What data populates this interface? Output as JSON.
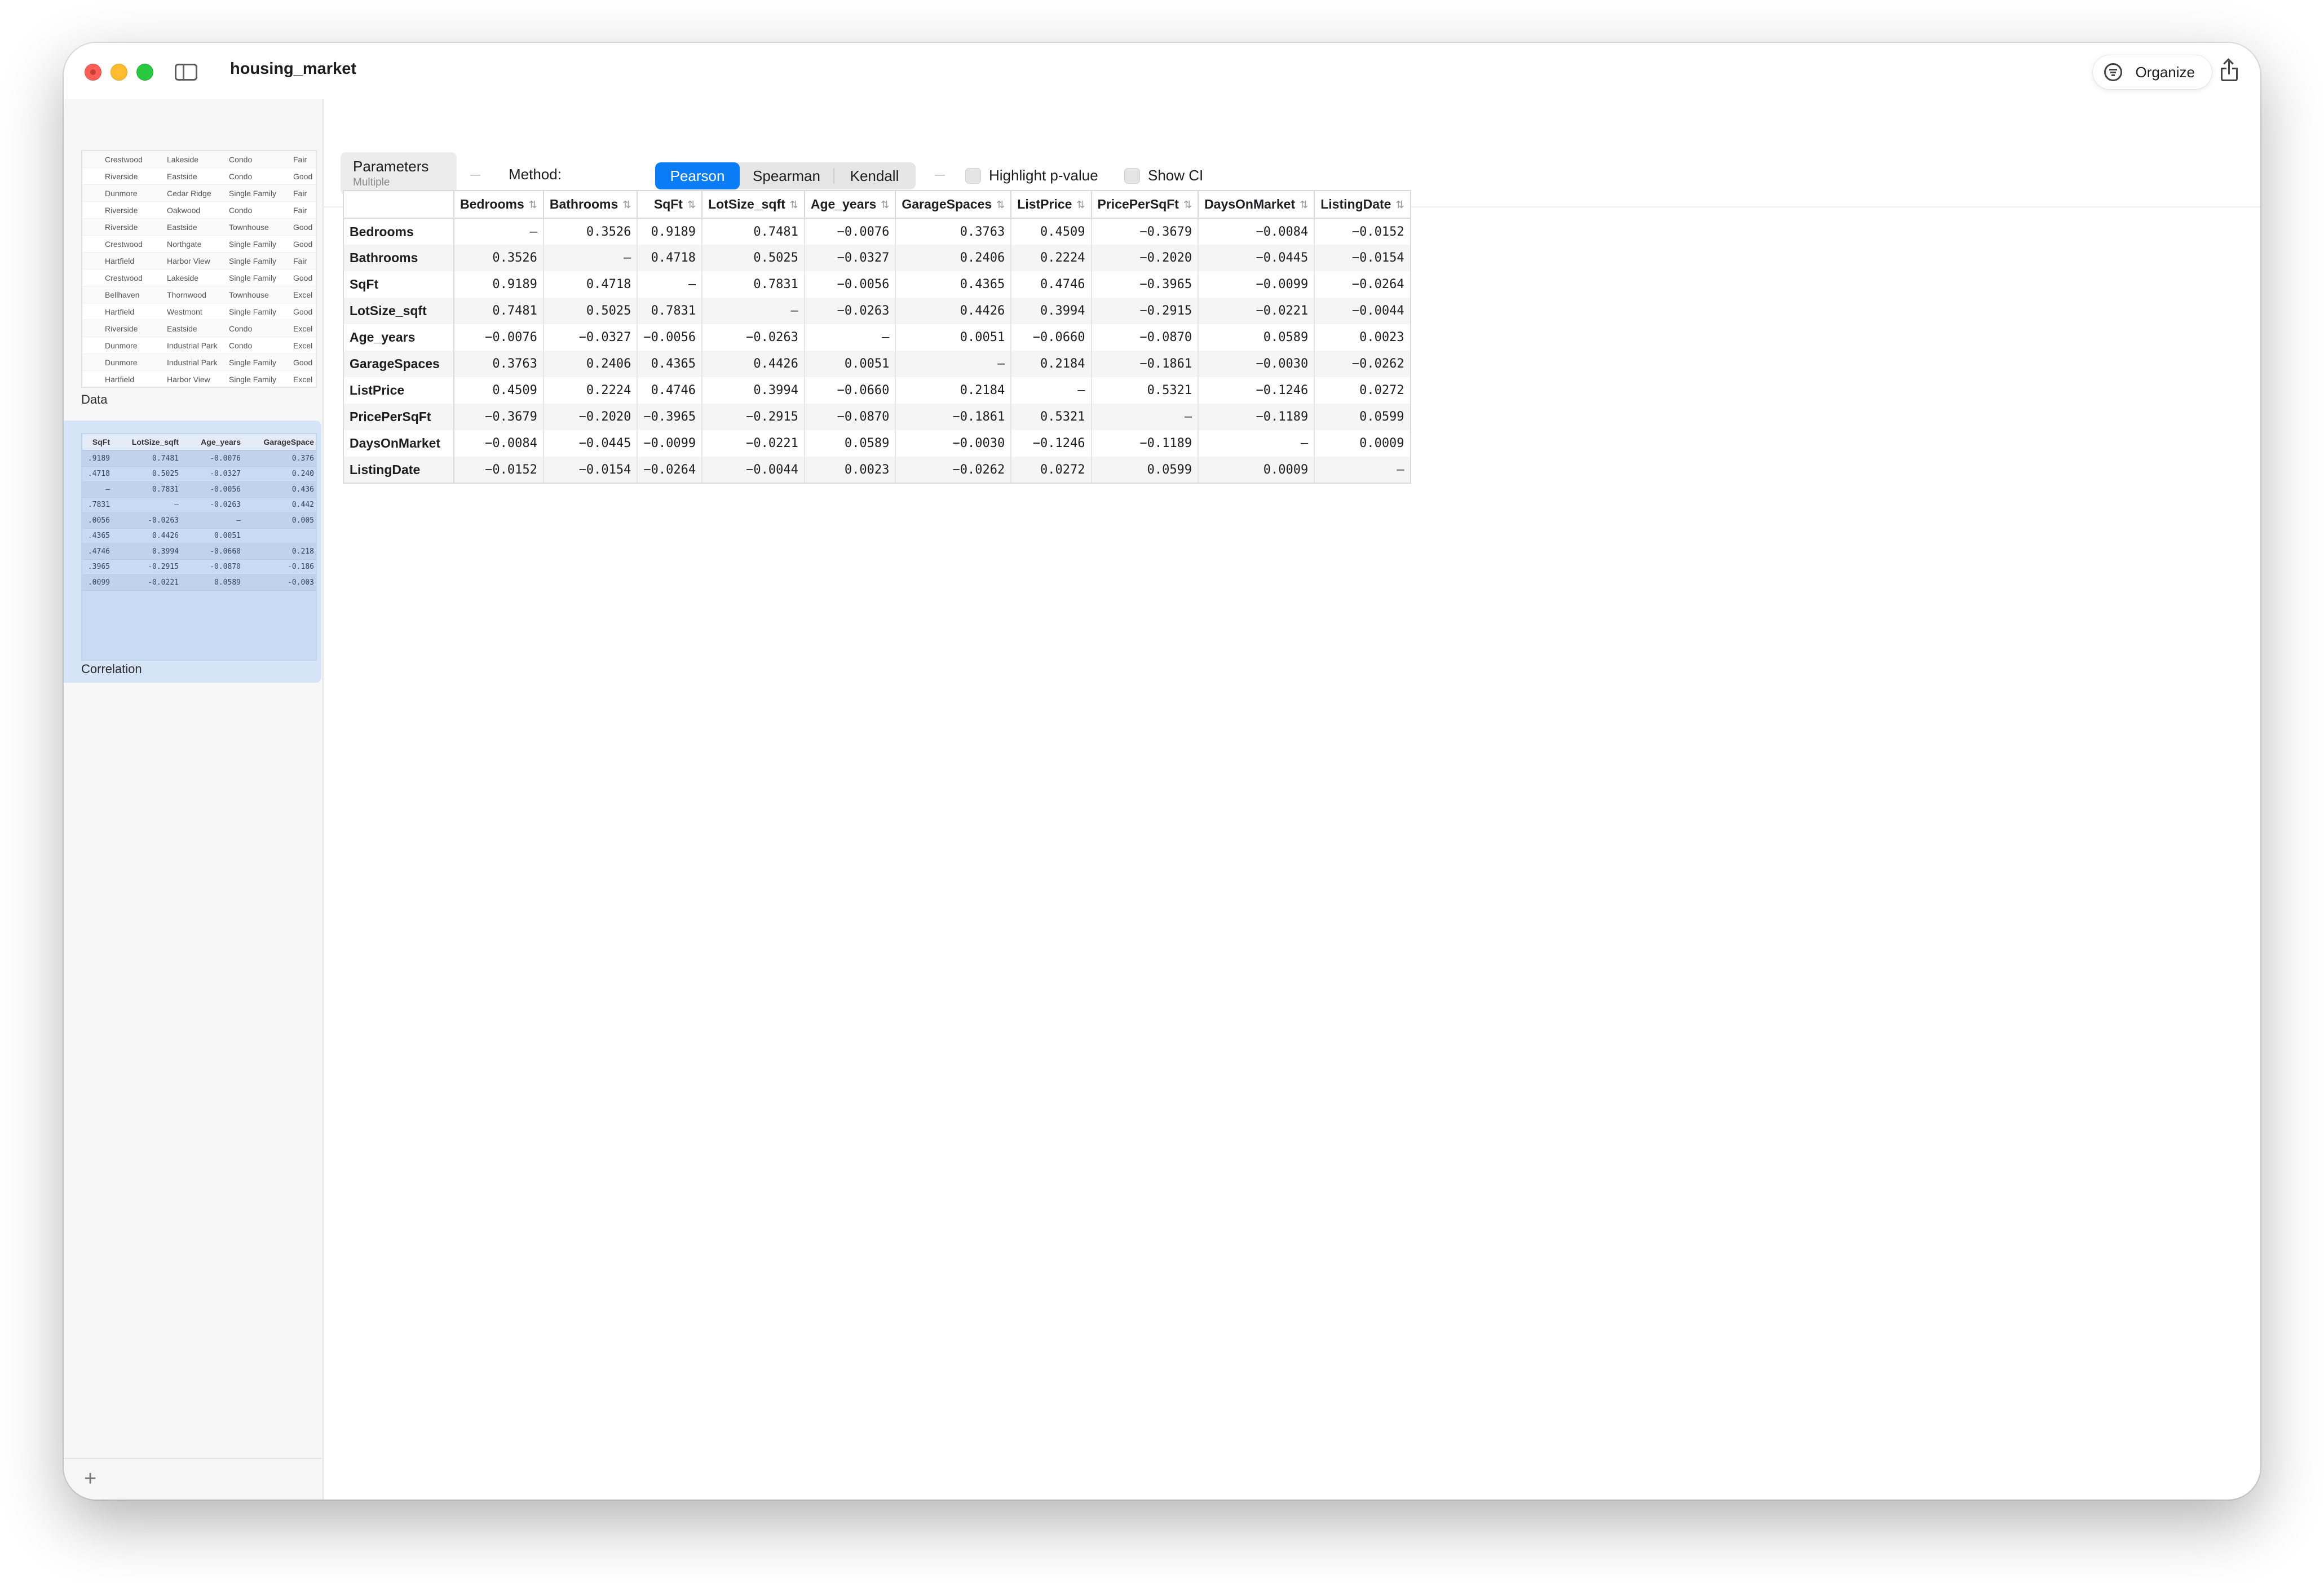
{
  "window": {
    "title": "housing_market"
  },
  "toolbar": {
    "organize_label": "Organize"
  },
  "sidebar": {
    "items": [
      {
        "label": "Data",
        "rows": [
          [
            "Crestwood",
            "Lakeside",
            "Condo",
            "Fair"
          ],
          [
            "Riverside",
            "Eastside",
            "Condo",
            "Good"
          ],
          [
            "Dunmore",
            "Cedar Ridge",
            "Single Family",
            "Fair"
          ],
          [
            "Riverside",
            "Oakwood",
            "Condo",
            "Fair"
          ],
          [
            "Riverside",
            "Eastside",
            "Townhouse",
            "Good"
          ],
          [
            "Crestwood",
            "Northgate",
            "Single Family",
            "Good"
          ],
          [
            "Hartfield",
            "Harbor View",
            "Single Family",
            "Fair"
          ],
          [
            "Crestwood",
            "Lakeside",
            "Single Family",
            "Good"
          ],
          [
            "Bellhaven",
            "Thornwood",
            "Townhouse",
            "Excel"
          ],
          [
            "Hartfield",
            "Westmont",
            "Single Family",
            "Good"
          ],
          [
            "Riverside",
            "Eastside",
            "Condo",
            "Excel"
          ],
          [
            "Dunmore",
            "Industrial Park",
            "Condo",
            "Excel"
          ],
          [
            "Dunmore",
            "Industrial Park",
            "Single Family",
            "Good"
          ],
          [
            "Hartfield",
            "Harbor View",
            "Single Family",
            "Excel"
          ]
        ]
      },
      {
        "label": "Correlation",
        "headers": [
          "SqFt",
          "LotSize_sqft",
          "Age_years",
          "GarageSpace"
        ],
        "rows": [
          [
            ".9189",
            "0.7481",
            "-0.0076",
            "0.376"
          ],
          [
            ".4718",
            "0.5025",
            "-0.0327",
            "0.240"
          ],
          [
            "—",
            "0.7831",
            "-0.0056",
            "0.436"
          ],
          [
            ".7831",
            "—",
            "-0.0263",
            "0.442"
          ],
          [
            ".0056",
            "-0.0263",
            "—",
            "0.005"
          ],
          [
            ".4365",
            "0.4426",
            "0.0051",
            ""
          ],
          [
            ".4746",
            "0.3994",
            "-0.0660",
            "0.218"
          ],
          [
            ".3965",
            "-0.2915",
            "-0.0870",
            "-0.186"
          ],
          [
            ".0099",
            "-0.0221",
            "0.0589",
            "-0.003"
          ]
        ]
      }
    ]
  },
  "params": {
    "title": "Parameters",
    "subtitle": "Multiple",
    "method_label": "Method:",
    "methods": [
      "Pearson",
      "Spearman",
      "Kendall"
    ],
    "active_method": 0,
    "highlight_label": "Highlight p-value",
    "show_ci_label": "Show CI"
  },
  "table": {
    "columns": [
      "Bedrooms",
      "Bathrooms",
      "SqFt",
      "LotSize_sqft",
      "Age_years",
      "GarageSpaces",
      "ListPrice",
      "PricePerSqFt",
      "DaysOnMarket",
      "ListingDate"
    ],
    "rows": [
      {
        "label": "Bedrooms",
        "values": [
          "—",
          "0.3526",
          "0.9189",
          "0.7481",
          "−0.0076",
          "0.3763",
          "0.4509",
          "−0.3679",
          "−0.0084",
          "−0.0152"
        ]
      },
      {
        "label": "Bathrooms",
        "values": [
          "0.3526",
          "—",
          "0.4718",
          "0.5025",
          "−0.0327",
          "0.2406",
          "0.2224",
          "−0.2020",
          "−0.0445",
          "−0.0154"
        ]
      },
      {
        "label": "SqFt",
        "values": [
          "0.9189",
          "0.4718",
          "—",
          "0.7831",
          "−0.0056",
          "0.4365",
          "0.4746",
          "−0.3965",
          "−0.0099",
          "−0.0264"
        ]
      },
      {
        "label": "LotSize_sqft",
        "values": [
          "0.7481",
          "0.5025",
          "0.7831",
          "—",
          "−0.0263",
          "0.4426",
          "0.3994",
          "−0.2915",
          "−0.0221",
          "−0.0044"
        ]
      },
      {
        "label": "Age_years",
        "values": [
          "−0.0076",
          "−0.0327",
          "−0.0056",
          "−0.0263",
          "—",
          "0.0051",
          "−0.0660",
          "−0.0870",
          "0.0589",
          "0.0023"
        ]
      },
      {
        "label": "GarageSpaces",
        "values": [
          "0.3763",
          "0.2406",
          "0.4365",
          "0.4426",
          "0.0051",
          "—",
          "0.2184",
          "−0.1861",
          "−0.0030",
          "−0.0262"
        ]
      },
      {
        "label": "ListPrice",
        "values": [
          "0.4509",
          "0.2224",
          "0.4746",
          "0.3994",
          "−0.0660",
          "0.2184",
          "—",
          "0.5321",
          "−0.1246",
          "0.0272"
        ]
      },
      {
        "label": "PricePerSqFt",
        "values": [
          "−0.3679",
          "−0.2020",
          "−0.3965",
          "−0.2915",
          "−0.0870",
          "−0.1861",
          "0.5321",
          "—",
          "−0.1189",
          "0.0599"
        ]
      },
      {
        "label": "DaysOnMarket",
        "values": [
          "−0.0084",
          "−0.0445",
          "−0.0099",
          "−0.0221",
          "0.0589",
          "−0.0030",
          "−0.1246",
          "−0.1189",
          "—",
          "0.0009"
        ]
      },
      {
        "label": "ListingDate",
        "values": [
          "−0.0152",
          "−0.0154",
          "−0.0264",
          "−0.0044",
          "0.0023",
          "−0.0262",
          "0.0272",
          "0.0599",
          "0.0009",
          "—"
        ]
      }
    ]
  },
  "colors": {
    "accent": "#0a7cf6",
    "selection": "#d6e4f7"
  }
}
